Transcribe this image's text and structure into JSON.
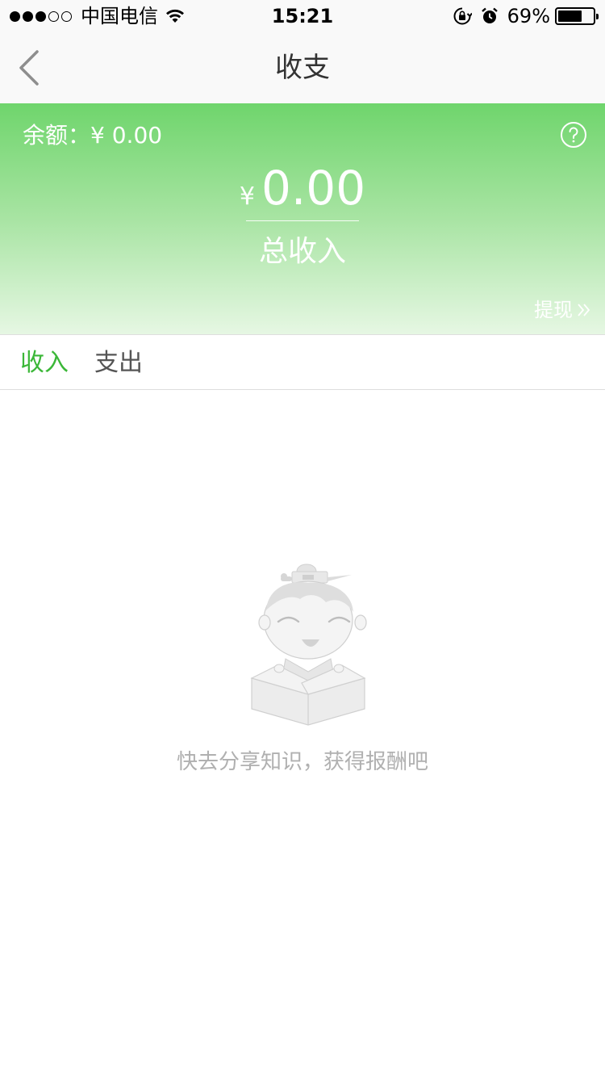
{
  "status_bar": {
    "signal": "●●●○○",
    "carrier": "中国电信",
    "time": "15:21",
    "battery_percent": "69%",
    "battery_level": 0.69,
    "icons": [
      "wifi-icon",
      "rotation-lock-icon",
      "alarm-icon",
      "battery-icon"
    ]
  },
  "nav": {
    "title": "收支",
    "back_icon": "chevron-left-icon"
  },
  "hero": {
    "balance_label": "余额：",
    "balance_value": "¥ 0.00",
    "currency_symbol": "¥",
    "amount": "0.00",
    "total_label": "总收入",
    "withdraw_label": "提现",
    "help_icon": "question-circle-icon",
    "withdraw_icon": "double-chevron-right-icon",
    "gradient_top": "#6fd56c",
    "gradient_bottom": "#e6f7e3"
  },
  "tabs": [
    {
      "label": "收入",
      "active": true
    },
    {
      "label": "支出",
      "active": false
    }
  ],
  "tab_active_color": "#3bb738",
  "empty": {
    "message": "快去分享知识，获得报酬吧",
    "illustration": "boy-in-box-illustration"
  }
}
